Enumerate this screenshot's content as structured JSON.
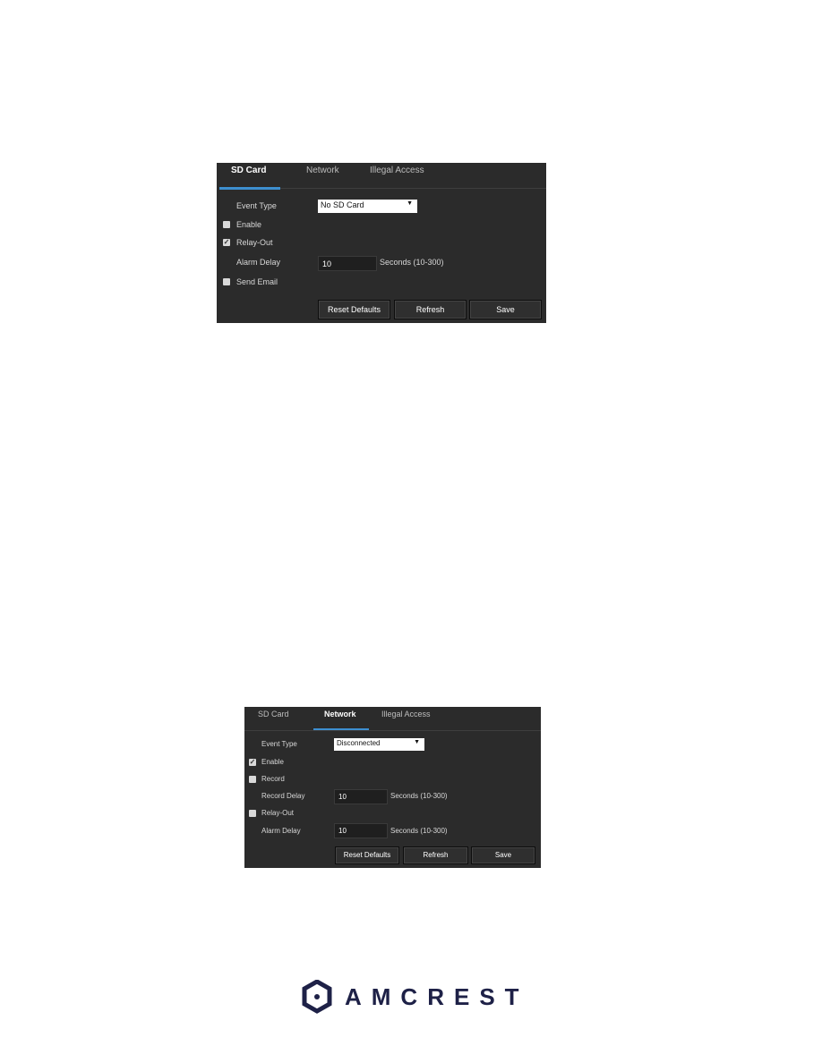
{
  "panel1": {
    "tabs": [
      {
        "label": "SD Card",
        "active": true
      },
      {
        "label": "Network",
        "active": false
      },
      {
        "label": "Illegal Access",
        "active": false
      }
    ],
    "event_type_label": "Event Type",
    "event_type_value": "No SD Card",
    "enable_label": "Enable",
    "enable_checked": false,
    "relay_out_label": "Relay-Out",
    "relay_out_checked": true,
    "alarm_delay_label": "Alarm Delay",
    "alarm_delay_value": "10",
    "alarm_delay_unit": "Seconds (10-300)",
    "send_email_label": "Send Email",
    "send_email_checked": false,
    "buttons": {
      "reset": "Reset Defaults",
      "refresh": "Refresh",
      "save": "Save"
    }
  },
  "panel2": {
    "tabs": [
      {
        "label": "SD Card",
        "active": false
      },
      {
        "label": "Network",
        "active": true
      },
      {
        "label": "Illegal Access",
        "active": false
      }
    ],
    "event_type_label": "Event Type",
    "event_type_value": "Disconnected",
    "enable_label": "Enable",
    "enable_checked": true,
    "record_label": "Record",
    "record_checked": false,
    "record_delay_label": "Record Delay",
    "record_delay_value": "10",
    "record_delay_unit": "Seconds (10-300)",
    "relay_out_label": "Relay-Out",
    "relay_out_checked": false,
    "alarm_delay_label": "Alarm Delay",
    "alarm_delay_value": "10",
    "alarm_delay_unit": "Seconds (10-300)",
    "buttons": {
      "reset": "Reset Defaults",
      "refresh": "Refresh",
      "save": "Save"
    }
  },
  "footer": {
    "brand": "AMCREST",
    "brand_color": "#1e2147",
    "accent_color": "#3d8fd0"
  }
}
